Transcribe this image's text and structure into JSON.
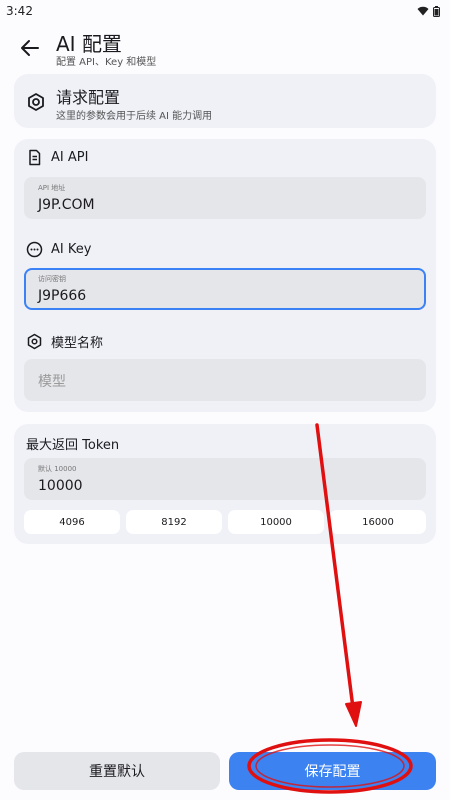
{
  "status_bar": {
    "time": "3:42"
  },
  "app_bar": {
    "title": "AI 配置",
    "subtitle": "配置 API、Key 和模型"
  },
  "request_card": {
    "title": "请求配置",
    "subtitle": "这里的参数会用于后续 AI 能力调用"
  },
  "api_section": {
    "label": "AI API",
    "field_label": "API 地址",
    "field_value": "J9P.COM"
  },
  "key_section": {
    "label": "AI Key",
    "field_label": "访问密钥",
    "field_value": "J9P666"
  },
  "model_section": {
    "label": "模型名称",
    "placeholder": "模型"
  },
  "token_section": {
    "title": "最大返回 Token",
    "field_label": "默认 10000",
    "field_value": "10000",
    "presets": [
      "4096",
      "8192",
      "10000",
      "16000"
    ]
  },
  "actions": {
    "reset_label": "重置默认",
    "save_label": "保存配置"
  },
  "colors": {
    "accent": "#3c82f0",
    "annotation": "#e01010"
  }
}
